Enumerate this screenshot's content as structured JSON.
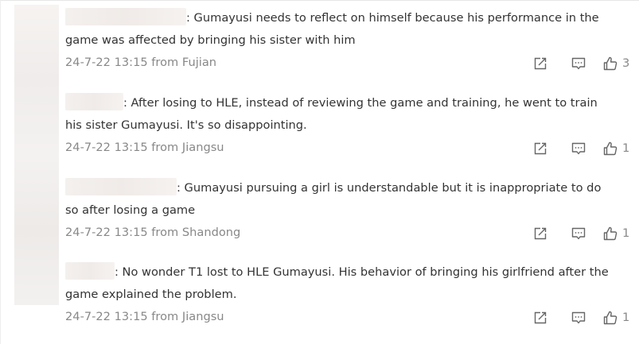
{
  "comments": [
    {
      "text": ": Gumayusi needs to reflect on himself because his performance in the game was affected by bringing his sister with him",
      "meta": "24-7-22 13:15 from Fujian",
      "likes": "3"
    },
    {
      "text": ": After losing to HLE, instead of reviewing the game and training, he went to train his sister Gumayusi. It's so disappointing.",
      "meta": "24-7-22 13:15 from Jiangsu",
      "likes": "1"
    },
    {
      "text": ": Gumayusi pursuing a girl is understandable but it is inappropriate to do so after losing a game",
      "meta": "24-7-22 13:15 from Shandong",
      "likes": "1"
    },
    {
      "text": ": No wonder T1 lost to HLE Gumayusi. His behavior of bringing his girlfriend after the game explained the problem.",
      "meta": "24-7-22 13:15 from Jiangsu",
      "likes": "1"
    }
  ],
  "icons": {
    "share": "share-icon",
    "comment": "comment-icon",
    "like": "like-icon"
  },
  "colors": {
    "text": "#333333",
    "meta": "#888888",
    "icon": "#666666"
  }
}
